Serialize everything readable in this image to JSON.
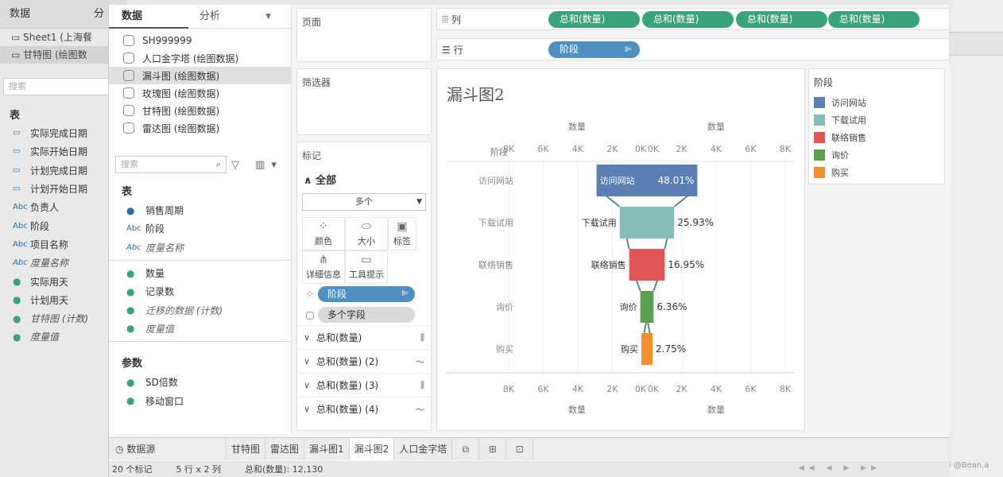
{
  "back": {
    "tab_data": "数据",
    "tab_analysis": "分",
    "sheets": [
      "Sheet1 (上海餐",
      "甘特图 (绘图数"
    ],
    "search_placeholder": "搜索",
    "section_tables": "表",
    "fields": [
      {
        "icon": "calendar",
        "label": "实际完成日期"
      },
      {
        "icon": "calendar",
        "label": "实际开始日期"
      },
      {
        "icon": "calendar",
        "label": "计划完成日期"
      },
      {
        "icon": "calendar",
        "label": "计划开始日期"
      },
      {
        "icon": "Abc",
        "label": "负责人"
      },
      {
        "icon": "Abc",
        "label": "阶段"
      },
      {
        "icon": "Abc",
        "label": "项目名称"
      },
      {
        "icon": "Abc",
        "label": "度量名称",
        "italic": true
      },
      {
        "icon": "measure",
        "label": "实际用天"
      },
      {
        "icon": "measure",
        "label": "计划用天"
      },
      {
        "icon": "measure",
        "label": "甘特图 (计数)",
        "italic": true
      },
      {
        "icon": "measure",
        "label": "度量值",
        "italic": true
      }
    ],
    "watermark": "CSDN @Bean.a"
  },
  "data_pane": {
    "tab_data": "数据",
    "tab_analysis": "分析",
    "datasources": [
      {
        "label": "SH999999",
        "selected": false
      },
      {
        "label": "人口金字塔 (绘图数据)",
        "selected": false
      },
      {
        "label": "漏斗图 (绘图数据)",
        "selected": true
      },
      {
        "label": "玫瑰图 (绘图数据)",
        "selected": false
      },
      {
        "label": "甘特图 (绘图数据)",
        "selected": false
      },
      {
        "label": "雷达图 (绘图数据)",
        "selected": false
      }
    ],
    "search_placeholder": "搜索",
    "section_tables": "表",
    "dims": [
      {
        "icon": "dot-blue",
        "label": "销售周期"
      },
      {
        "icon": "Abc",
        "label": "阶段"
      },
      {
        "icon": "Abc",
        "label": "度量名称",
        "italic": true
      }
    ],
    "measures": [
      {
        "icon": "measure",
        "label": "数量"
      },
      {
        "icon": "measure",
        "label": "记录数"
      },
      {
        "icon": "measure",
        "label": "迁移的数据 (计数)",
        "italic": true
      },
      {
        "icon": "measure",
        "label": "度量值",
        "italic": true
      }
    ],
    "section_params": "参数",
    "params": [
      {
        "icon": "measure",
        "label": "SD倍数"
      },
      {
        "icon": "measure",
        "label": "移动窗口"
      }
    ]
  },
  "pages_card": {
    "title": "页面"
  },
  "filters_card": {
    "title": "筛选器"
  },
  "marks_card": {
    "title": "标记",
    "all_label": "全部",
    "type_value": "多个",
    "buttons": [
      {
        "icon": "color-icon",
        "label": "颜色"
      },
      {
        "icon": "size-icon",
        "label": "大小"
      },
      {
        "icon": "label-icon",
        "label": "标签"
      },
      {
        "icon": "detail-icon",
        "label": "详细信息"
      },
      {
        "icon": "tooltip-icon",
        "label": "工具提示"
      }
    ],
    "stage_pill": "阶段",
    "multi_pill": "多个字段",
    "subcards": [
      "总和(数量)",
      "总和(数量) (2)",
      "总和(数量) (3)",
      "总和(数量) (4)"
    ]
  },
  "shelves": {
    "columns_label": "列",
    "rows_label": "行",
    "columns_pills": [
      "总和(数量)",
      "总和(数量)",
      "总和(数量)",
      "总和(数量)"
    ],
    "rows_pills": [
      "阶段"
    ]
  },
  "viz": {
    "title": "漏斗图2"
  },
  "legend": {
    "title": "阶段",
    "items": [
      {
        "label": "访问网站",
        "color": "#5b7fb5"
      },
      {
        "label": "下载试用",
        "color": "#86bcb6"
      },
      {
        "label": "联络销售",
        "color": "#e15759"
      },
      {
        "label": "询价",
        "color": "#59a14f"
      },
      {
        "label": "购买",
        "color": "#f28e2b"
      }
    ]
  },
  "chart_data": {
    "type": "bar",
    "title": "漏斗图2",
    "row_header": "阶段",
    "xlabel": "数量",
    "x_ticks_left": [
      "8K",
      "6K",
      "4K",
      "2K",
      "0K"
    ],
    "x_ticks_right": [
      "0K",
      "2K",
      "4K",
      "6K",
      "8K"
    ],
    "xlim": [
      -8000,
      8000
    ],
    "categories": [
      "访问网站",
      "下载试用",
      "联络销售",
      "询价",
      "购买"
    ],
    "values": [
      5830,
      3150,
      2060,
      770,
      330
    ],
    "percent_labels": [
      "48.01%",
      "25.93%",
      "16.95%",
      "6.36%",
      "2.75%"
    ],
    "colors": [
      "#5b7fb5",
      "#86bcb6",
      "#e15759",
      "#59a14f",
      "#f28e2b"
    ],
    "grid": true
  },
  "sheet_tabs": {
    "datasource": "数据源",
    "tabs": [
      {
        "label": "甘特图",
        "active": false
      },
      {
        "label": "雷达图",
        "active": false
      },
      {
        "label": "漏斗图1",
        "active": false
      },
      {
        "label": "漏斗图2",
        "active": true
      },
      {
        "label": "人口金字塔",
        "active": false
      }
    ]
  },
  "status": {
    "marks": "20 个标记",
    "dims": "5 行 x 2 列",
    "sum": "总和(数量): 12,130"
  }
}
